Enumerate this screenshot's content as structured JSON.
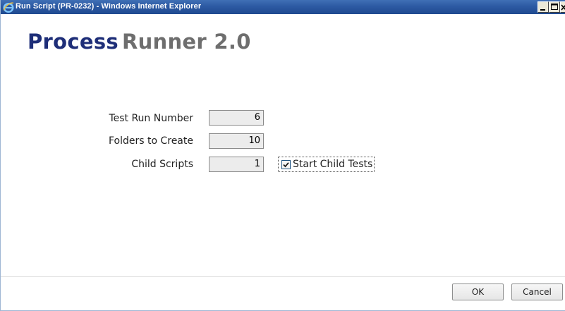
{
  "window": {
    "title": "Run Script (PR-0232) - Windows Internet Explorer",
    "browser_icon": "internet-explorer-icon",
    "controls": {
      "minimize_icon": "minimize-icon",
      "maximize_icon": "maximize-icon",
      "close_icon": "close-icon"
    }
  },
  "logo": {
    "part1": "Process",
    "part2": "Runner 2.0",
    "colors": {
      "part1": "#1e2e78",
      "part2": "#6e6e6e"
    }
  },
  "form": {
    "fields": [
      {
        "label": "Test Run Number",
        "value": "6"
      },
      {
        "label": "Folders to Create",
        "value": "10"
      },
      {
        "label": "Child Scripts",
        "value": "1"
      }
    ],
    "start_child_tests": {
      "label": "Start Child Tests",
      "checked": true
    }
  },
  "buttons": {
    "ok": "OK",
    "cancel": "Cancel"
  }
}
